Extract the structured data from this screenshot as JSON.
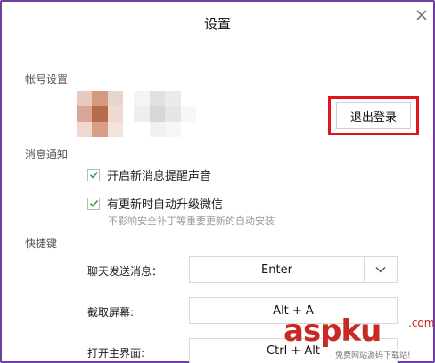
{
  "window": {
    "title": "设置"
  },
  "account": {
    "section_label": "帐号设置",
    "logout_label": "退出登录"
  },
  "notifications": {
    "section_label": "消息通知",
    "options": [
      {
        "label": "开启新消息提醒声音",
        "checked": true
      },
      {
        "label": "有更新时自动升级微信",
        "checked": true
      }
    ],
    "hint": "不影响安全补丁等重要更新的自动安装"
  },
  "shortcuts": {
    "section_label": "快捷键",
    "items": [
      {
        "label": "聊天发送消息：",
        "value": "Enter"
      },
      {
        "label": "截取屏幕:",
        "value": "Alt + A"
      },
      {
        "label": "打开主界面:",
        "value": "Ctrl + Alt"
      }
    ]
  },
  "watermark": {
    "brand": "asp",
    "brand_ku": "ku",
    "brand_suffix": ".com",
    "tagline": "免费网站源码下载站!"
  },
  "colors": {
    "accent_check": "#2e9e3e",
    "highlight_red": "#e0141e",
    "window_border": "#6b3fa0"
  },
  "icons": {
    "close": "close-icon",
    "check": "check-icon",
    "dropdown": "chevron-down-icon"
  }
}
